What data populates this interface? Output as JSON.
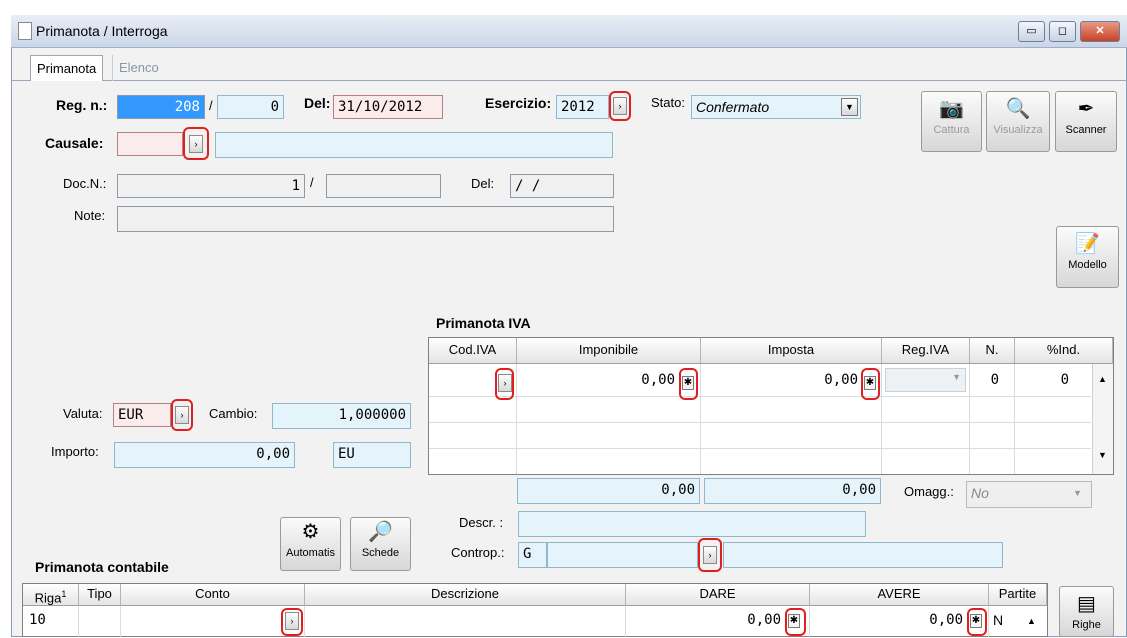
{
  "window": {
    "title": "Primanota / Interroga",
    "min": "▭",
    "max": "◻",
    "close": "✕"
  },
  "tabs": [
    {
      "label": "Primanota"
    },
    {
      "label": "Elenco"
    }
  ],
  "header": {
    "reg_label": "Reg. n.:",
    "reg_num": "208",
    "reg_sep": "/",
    "reg_sub": "0",
    "del_label": "Del:",
    "del_value": "31/10/2012",
    "esercizio_label": "Esercizio:",
    "esercizio_value": "2012",
    "stato_label": "Stato:",
    "stato_value": "Confermato",
    "causale_label": "Causale:",
    "causale_code": "",
    "causale_desc": "",
    "docn_label": "Doc.N.:",
    "docn_value": "1",
    "docn_sep": "/",
    "docn_alpha": "",
    "docdel_label": "Del:",
    "docdel_value": " /  /",
    "note_label": "Note:",
    "note_value": ""
  },
  "toolbar": {
    "cattura": "Cattura",
    "visualizza": "Visualizza",
    "scanner": "Scanner",
    "modello": "Modello"
  },
  "valuta": {
    "valuta_label": "Valuta:",
    "valuta_value": "EUR",
    "cambio_label": "Cambio:",
    "cambio_value": "1,000000",
    "importo_label": "Importo:",
    "importo_value": "0,00",
    "importo_curr": "EU"
  },
  "iva": {
    "title": "Primanota IVA",
    "columns": [
      "Cod.IVA",
      "Imponibile",
      "Imposta",
      "Reg.IVA",
      "N.",
      "%Ind."
    ],
    "row1": {
      "cod": "",
      "imponibile": "0,00",
      "imposta": "0,00",
      "regiva": "",
      "n": "0",
      "ind": "0"
    },
    "tot_imponibile": "0,00",
    "tot_imposta": "0,00",
    "omagg_label": "Omagg.:",
    "omagg_value": "No",
    "descr_label": "Descr. :",
    "descr_value": "",
    "controp_label": "Controp.:",
    "controp_type": "G",
    "controp_code": "",
    "controp_desc": ""
  },
  "buttons": {
    "automatis": "Automatis",
    "schede": "Schede",
    "righe": "Righe"
  },
  "contabile": {
    "title": "Primanota contabile",
    "columns": [
      "Riga",
      "Tipo",
      "Conto",
      "Descrizione",
      "DARE",
      "AVERE",
      "Partite"
    ],
    "sort_indicator": "1",
    "row1": {
      "riga": "10",
      "tipo": "",
      "conto": "",
      "descrizione": "",
      "dare": "0,00",
      "avere": "0,00",
      "partite": "N"
    }
  },
  "icons": {
    "zoom": "›",
    "star": "✱",
    "dropdown": "▼",
    "scroll_up": "▲",
    "scroll_down": "▼"
  }
}
